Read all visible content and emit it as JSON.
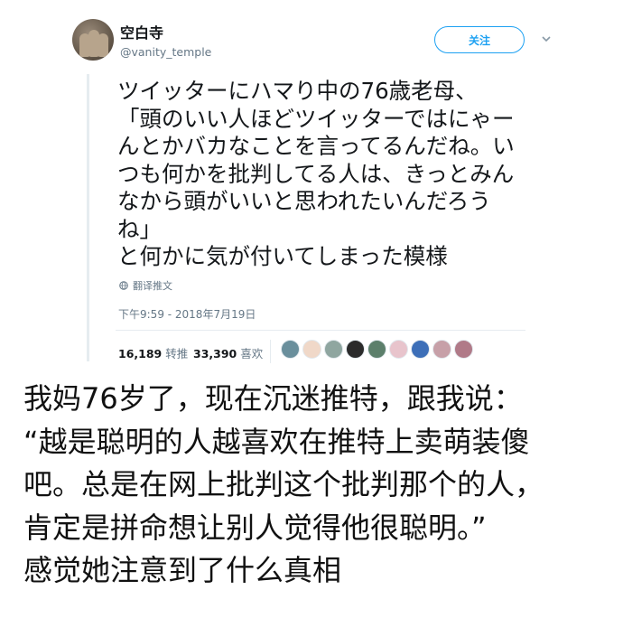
{
  "tweet": {
    "display_name": "空白寺",
    "handle": "@vanity_temple",
    "follow_label": "关注",
    "text_lines": [
      "ツイッターにハマり中の76歳老母、",
      "「頭のいい人ほどツイッターではにゃー",
      "んとかバカなことを言ってるんだね。い",
      "つも何かを批判してる人は、きっとみん",
      "なから頭がいいと思われたいんだろう",
      "ね」",
      "と何かに気が付いてしまった模様"
    ],
    "translate_label": "翻译推文",
    "timestamp": "下午9:59 - 2018年7月19日",
    "retweets": {
      "count": "16,189",
      "label": "转推"
    },
    "likes": {
      "count": "33,390",
      "label": "喜欢"
    },
    "liker_avatars": [
      {
        "name": "liker-avatar-1",
        "color": "#6a8f9c"
      },
      {
        "name": "liker-avatar-2",
        "color": "#f0d8c8"
      },
      {
        "name": "liker-avatar-3",
        "color": "#8fa6a0"
      },
      {
        "name": "liker-avatar-4",
        "color": "#2b2b2b"
      },
      {
        "name": "liker-avatar-5",
        "color": "#5c7f6b"
      },
      {
        "name": "liker-avatar-6",
        "color": "#e8c4cc"
      },
      {
        "name": "liker-avatar-7",
        "color": "#3d6fb8"
      },
      {
        "name": "liker-avatar-8",
        "color": "#c7a0a8"
      },
      {
        "name": "liker-avatar-9",
        "color": "#b07a88"
      }
    ]
  },
  "caption": {
    "lines": [
      "我妈76岁了，现在沉迷推特，跟我说：",
      "“越是聪明的人越喜欢在推特上卖萌装傻",
      "吧。总是在网上批判这个批判那个的人，",
      "肯定是拼命想让别人觉得他很聪明。”",
      "感觉她注意到了什么真相"
    ]
  },
  "colors": {
    "accent": "#1da1f2",
    "secondary_text": "#657786",
    "divider": "#e6ecf0"
  }
}
